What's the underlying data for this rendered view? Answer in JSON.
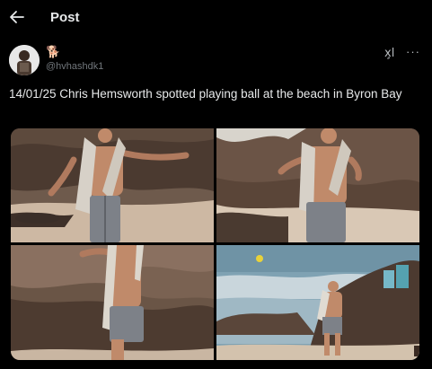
{
  "header": {
    "title": "Post",
    "back_icon": "arrow-left-icon"
  },
  "author": {
    "display_name": "🐕",
    "handle": "@hvhashdk1",
    "avatar_icon": "avatar-photo"
  },
  "actions": {
    "grok_label": "x̧l",
    "more_label": "···"
  },
  "tweet": {
    "text": "14/01/25 Chris Hemsworth spotted playing ball at the beach in Byron Bay"
  },
  "media": [
    {
      "description_icon": "photo-1"
    },
    {
      "description_icon": "photo-2"
    },
    {
      "description_icon": "photo-3"
    },
    {
      "description_icon": "photo-4"
    }
  ],
  "colors": {
    "background": "#000000",
    "text": "#e7e9ea",
    "muted": "#71767b"
  }
}
